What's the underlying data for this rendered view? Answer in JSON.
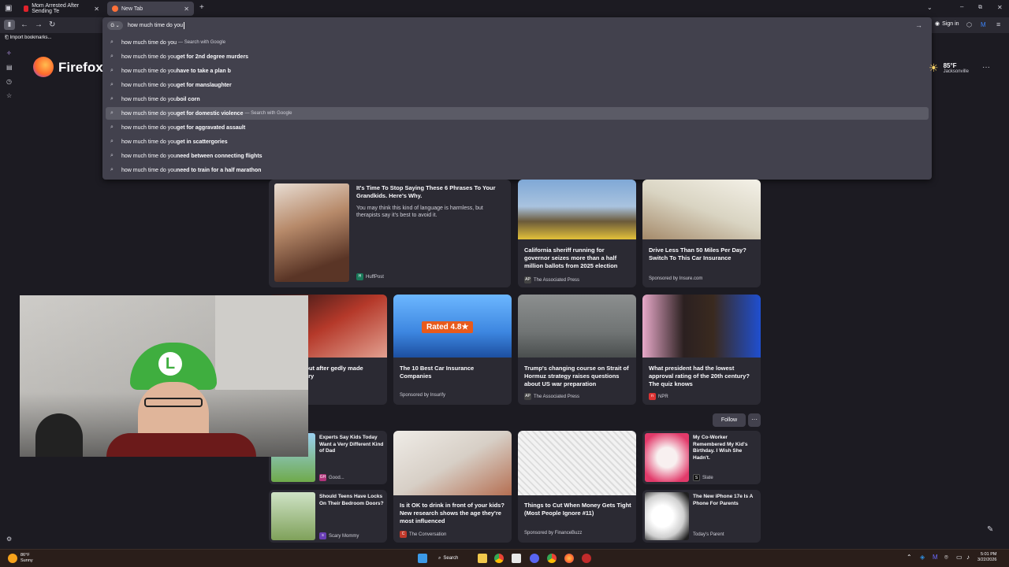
{
  "tabs": [
    {
      "label": "Mom Arrested After Sending Te",
      "active": false
    },
    {
      "label": "New Tab",
      "active": true
    }
  ],
  "urlbar": {
    "value": "how much time do you ",
    "go_icon": "arrow-right-icon"
  },
  "suggestions": [
    {
      "prefix": "how much time do you",
      "bold": "",
      "action": "— Search with Google",
      "highlighted": false
    },
    {
      "prefix": "how much time do you ",
      "bold": "get for 2nd degree murders",
      "action": "",
      "highlighted": false
    },
    {
      "prefix": "how much time do you ",
      "bold": "have to take a plan b",
      "action": "",
      "highlighted": false
    },
    {
      "prefix": "how much time do you ",
      "bold": "get for manslaughter",
      "action": "",
      "highlighted": false
    },
    {
      "prefix": "how much time do you ",
      "bold": "boil corn",
      "action": "",
      "highlighted": false
    },
    {
      "prefix": "how much time do you ",
      "bold": "get for domestic violence",
      "action": "— Search with Google",
      "highlighted": true
    },
    {
      "prefix": "how much time do you ",
      "bold": "get for aggravated assault",
      "action": "",
      "highlighted": false
    },
    {
      "prefix": "how much time do you ",
      "bold": "get in scattergories",
      "action": "",
      "highlighted": false
    },
    {
      "prefix": "how much time do you ",
      "bold": "need between connecting flights",
      "action": "",
      "highlighted": false
    },
    {
      "prefix": "how much time do you ",
      "bold": "need to train for a half marathon",
      "action": "",
      "highlighted": false
    }
  ],
  "toolbar": {
    "sign_in": "Sign in"
  },
  "bookmarks": {
    "import": "Import bookmarks..."
  },
  "brand": {
    "name": "Firefox"
  },
  "weather": {
    "temp": "85°F",
    "city": "Jacksonville"
  },
  "stories": {
    "featured": {
      "title": "It's Time To Stop Saying These 6 Phrases To Your Grandkids. Here's Why.",
      "desc": "You may think this kind of language is harmless, but therapists say it's best to avoid it.",
      "source": "HuffPost"
    },
    "row1": [
      {
        "title": "California sheriff running for governor seizes more than a half million ballots from 2025 election",
        "source": "The Associated Press"
      },
      {
        "title": "Drive Less Than 50 Miles Per Day? Switch To This Car Insurance",
        "source": "Sponsored by Insure.com"
      }
    ],
    "row2": [
      {
        "title": "an speaks out after gedly made young fan cry",
        "source": "Y"
      },
      {
        "title": "The 10 Best Car Insurance Companies",
        "source": "Sponsored by Insurify",
        "badge": "Rated 4.8★"
      },
      {
        "title": "Trump's changing course on Strait of Hormuz strategy raises questions about US war preparation",
        "source": "The Associated Press"
      },
      {
        "title": "What president had the lowest approval rating of the 20th century? The quiz knows",
        "source": "NPR"
      }
    ],
    "follow": "Follow",
    "row3": [
      {
        "title": "Experts Say Kids Today Want a Very Different Kind of Dad",
        "source": "Good..."
      },
      {
        "title": "My Co-Worker Remembered My Kid's Birthday. I Wish She Hadn't.",
        "source": "Slate"
      }
    ],
    "row3_wide": [
      {
        "title": "Is it OK to drink in front of your kids? New research shows the age they're most influenced",
        "source": "The Conversation"
      },
      {
        "title": "Things to Cut When Money Gets Tight (Most People Ignore #11)",
        "source": "Sponsored by FinanceBuzz"
      }
    ],
    "row4": [
      {
        "title": "Should Teens Have Locks On Their Bedroom Doors?",
        "source": "Scary Mommy"
      },
      {
        "title": "The New iPhone 17e Is A Phone For Parents",
        "source": "Today's Parent"
      }
    ]
  },
  "taskbar": {
    "weather_temp": "86°F",
    "weather_desc": "Sunny",
    "search": "Search",
    "time": "5:01 PM",
    "date": "3/22/2026"
  }
}
